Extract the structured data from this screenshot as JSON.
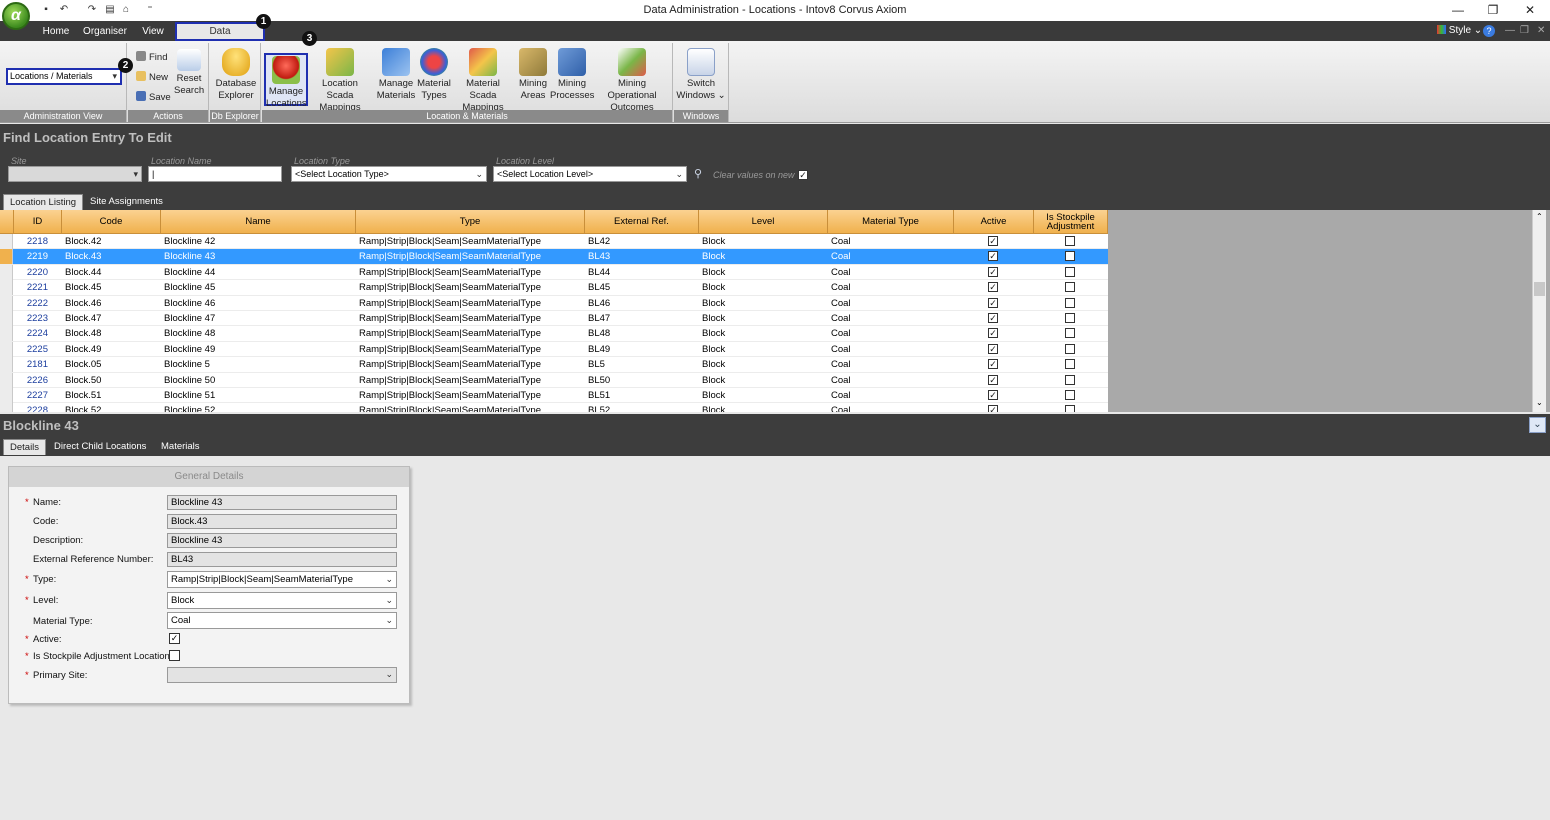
{
  "window": {
    "title": "Data Administration - Locations - Intov8 Corvus Axiom",
    "logo": "α"
  },
  "menu_tabs": [
    "Home",
    "Organiser",
    "View",
    "Data Administration"
  ],
  "style_label": "Style",
  "ribbon": {
    "admin_view_value": "Locations / Materials",
    "groups": {
      "admin_view": "Administration View",
      "actions": "Actions",
      "db_explorer": "Db Explorer",
      "location_materials": "Location & Materials",
      "windows": "Windows"
    },
    "actions": {
      "find": "Find",
      "new": "New",
      "save": "Save",
      "reset_search_1": "Reset",
      "reset_search_2": "Search"
    },
    "buttons": [
      {
        "l1": "Database",
        "l2": "Explorer"
      },
      {
        "l1": "Manage",
        "l2": "Locations"
      },
      {
        "l1": "Location Scada",
        "l2": "Mappings"
      },
      {
        "l1": "Manage",
        "l2": "Materials"
      },
      {
        "l1": "Material",
        "l2": "Types"
      },
      {
        "l1": "Material Scada",
        "l2": "Mappings"
      },
      {
        "l1": "Mining",
        "l2": "Areas"
      },
      {
        "l1": "Mining",
        "l2": "Processes"
      },
      {
        "l1": "Mining Operational",
        "l2": "Outcomes"
      },
      {
        "l1": "Switch",
        "l2": "Windows ⌄"
      }
    ],
    "badges": [
      "1",
      "2",
      "3"
    ]
  },
  "find": {
    "title": "Find Location Entry To Edit",
    "site_label": "Site",
    "site_value": "",
    "name_label": "Location Name",
    "name_value": "|",
    "type_label": "Location Type",
    "type_value": "<Select Location Type>",
    "level_label": "Location Level",
    "level_value": "<Select Location Level>",
    "clear_label": "Clear values on new"
  },
  "listing_tabs": [
    "Location Listing",
    "Site Assignments"
  ],
  "grid": {
    "columns": [
      "ID",
      "Code",
      "Name",
      "Type",
      "External Ref.",
      "Level",
      "Material Type",
      "Active",
      "Is Stockpile Adjustment"
    ],
    "selected_index": 1,
    "rows": [
      {
        "id": "2218",
        "code": "Block.42",
        "name": "Blockline 42",
        "type": "Ramp|Strip|Block|Seam|SeamMaterialType",
        "ext": "BL42",
        "level": "Block",
        "mat": "Coal",
        "active": true,
        "stockpile": false
      },
      {
        "id": "2219",
        "code": "Block.43",
        "name": "Blockline 43",
        "type": "Ramp|Strip|Block|Seam|SeamMaterialType",
        "ext": "BL43",
        "level": "Block",
        "mat": "Coal",
        "active": true,
        "stockpile": false
      },
      {
        "id": "2220",
        "code": "Block.44",
        "name": "Blockline 44",
        "type": "Ramp|Strip|Block|Seam|SeamMaterialType",
        "ext": "BL44",
        "level": "Block",
        "mat": "Coal",
        "active": true,
        "stockpile": false
      },
      {
        "id": "2221",
        "code": "Block.45",
        "name": "Blockline 45",
        "type": "Ramp|Strip|Block|Seam|SeamMaterialType",
        "ext": "BL45",
        "level": "Block",
        "mat": "Coal",
        "active": true,
        "stockpile": false
      },
      {
        "id": "2222",
        "code": "Block.46",
        "name": "Blockline 46",
        "type": "Ramp|Strip|Block|Seam|SeamMaterialType",
        "ext": "BL46",
        "level": "Block",
        "mat": "Coal",
        "active": true,
        "stockpile": false
      },
      {
        "id": "2223",
        "code": "Block.47",
        "name": "Blockline 47",
        "type": "Ramp|Strip|Block|Seam|SeamMaterialType",
        "ext": "BL47",
        "level": "Block",
        "mat": "Coal",
        "active": true,
        "stockpile": false
      },
      {
        "id": "2224",
        "code": "Block.48",
        "name": "Blockline 48",
        "type": "Ramp|Strip|Block|Seam|SeamMaterialType",
        "ext": "BL48",
        "level": "Block",
        "mat": "Coal",
        "active": true,
        "stockpile": false
      },
      {
        "id": "2225",
        "code": "Block.49",
        "name": "Blockline 49",
        "type": "Ramp|Strip|Block|Seam|SeamMaterialType",
        "ext": "BL49",
        "level": "Block",
        "mat": "Coal",
        "active": true,
        "stockpile": false
      },
      {
        "id": "2181",
        "code": "Block.05",
        "name": "Blockline 5",
        "type": "Ramp|Strip|Block|Seam|SeamMaterialType",
        "ext": "BL5",
        "level": "Block",
        "mat": "Coal",
        "active": true,
        "stockpile": false
      },
      {
        "id": "2226",
        "code": "Block.50",
        "name": "Blockline 50",
        "type": "Ramp|Strip|Block|Seam|SeamMaterialType",
        "ext": "BL50",
        "level": "Block",
        "mat": "Coal",
        "active": true,
        "stockpile": false
      },
      {
        "id": "2227",
        "code": "Block.51",
        "name": "Blockline 51",
        "type": "Ramp|Strip|Block|Seam|SeamMaterialType",
        "ext": "BL51",
        "level": "Block",
        "mat": "Coal",
        "active": true,
        "stockpile": false
      },
      {
        "id": "2228",
        "code": "Block.52",
        "name": "Blockline 52",
        "type": "Ramp|Strip|Block|Seam|SeamMaterialType",
        "ext": "BL52",
        "level": "Block",
        "mat": "Coal",
        "active": true,
        "stockpile": false
      }
    ]
  },
  "detail": {
    "title": "Blockline 43",
    "tabs": [
      "Details",
      "Direct Child Locations",
      "Materials"
    ],
    "section_title": "General Details",
    "fields": {
      "name_label": "Name:",
      "name_value": "Blockline 43",
      "code_label": "Code:",
      "code_value": "Block.43",
      "desc_label": "Description:",
      "desc_value": "Blockline 43",
      "ext_label": "External Reference Number:",
      "ext_value": "BL43",
      "type_label": "Type:",
      "type_value": "Ramp|Strip|Block|Seam|SeamMaterialType",
      "level_label": "Level:",
      "level_value": "Block",
      "mat_label": "Material Type:",
      "mat_value": "Coal",
      "active_label": "Active:",
      "stockpile_label": "Is Stockpile Adjustment Location:",
      "site_label": "Primary Site:",
      "site_value": ""
    }
  },
  "colors": {
    "highlight": "#1f2fb0",
    "grid_header": "#f0b14d",
    "selected_row": "#3399ff"
  }
}
